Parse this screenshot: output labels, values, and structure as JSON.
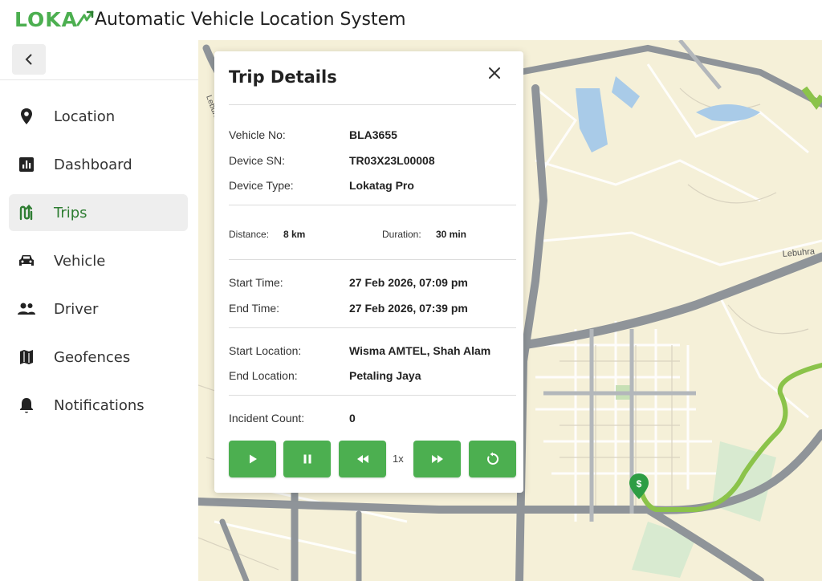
{
  "app": {
    "logo_text": "LOKA",
    "title": "Automatic Vehicle Location System"
  },
  "sidebar": {
    "collapse_icon": "chevron-left-icon",
    "items": [
      {
        "label": "Location",
        "icon": "location-pin-icon",
        "active": false
      },
      {
        "label": "Dashboard",
        "icon": "bar-chart-icon",
        "active": false
      },
      {
        "label": "Trips",
        "icon": "route-icon",
        "active": true
      },
      {
        "label": "Vehicle",
        "icon": "car-icon",
        "active": false
      },
      {
        "label": "Driver",
        "icon": "people-icon",
        "active": false
      },
      {
        "label": "Geofences",
        "icon": "map-icon",
        "active": false
      },
      {
        "label": "Notifications",
        "icon": "bell-icon",
        "active": false
      }
    ]
  },
  "trip_details": {
    "title": "Trip Details",
    "vehicle_no_label": "Vehicle No:",
    "vehicle_no": "BLA3655",
    "device_sn_label": "Device SN:",
    "device_sn": "TR03X23L00008",
    "device_type_label": "Device Type:",
    "device_type": "Lokatag Pro",
    "distance_label": "Distance:",
    "distance": "8 km",
    "duration_label": "Duration:",
    "duration": "30 min",
    "start_time_label": "Start Time:",
    "start_time": "27 Feb 2026, 07:09 pm",
    "end_time_label": "End Time:",
    "end_time": "27 Feb 2026, 07:39 pm",
    "start_location_label": "Start Location:",
    "start_location": "Wisma AMTEL, Shah Alam",
    "end_location_label": "End Location:",
    "end_location": "Petaling Jaya",
    "incident_count_label": "Incident Count:",
    "incident_count": "0"
  },
  "playback": {
    "speed": "1x",
    "buttons": [
      "play-icon",
      "pause-icon",
      "rewind-icon",
      "fast-forward-icon",
      "replay-icon"
    ]
  },
  "map": {
    "road_label": "Lebuhra",
    "road_label_left": "Lebuhr",
    "route_color": "#8bc34a",
    "start_marker": "$"
  },
  "colors": {
    "brand": "#4caf50",
    "active_text": "#2e7d32",
    "route": "#8bc34a"
  }
}
